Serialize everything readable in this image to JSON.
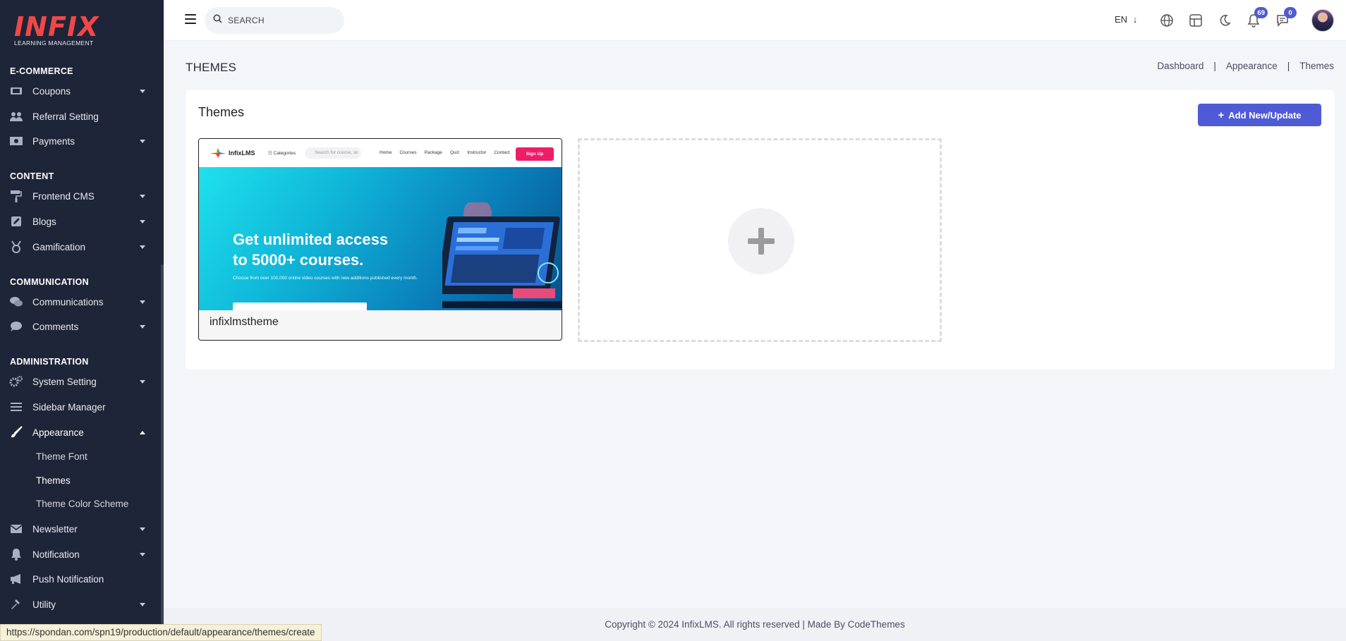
{
  "app": {
    "logo_word": "INFIX",
    "logo_tagline": "LEARNING MANAGEMENT"
  },
  "sidebar": {
    "sections": [
      {
        "label": "E-COMMERCE"
      },
      {
        "label": "CONTENT"
      },
      {
        "label": "COMMUNICATION"
      },
      {
        "label": "ADMINISTRATION"
      }
    ],
    "items": [
      {
        "label": "Coupons",
        "icon": "ticket-icon"
      },
      {
        "label": "Referral Setting",
        "icon": "users-icon"
      },
      {
        "label": "Payments",
        "icon": "money-icon"
      },
      {
        "label": "Frontend CMS",
        "icon": "paint-roller-icon"
      },
      {
        "label": "Blogs",
        "icon": "edit-icon"
      },
      {
        "label": "Gamification",
        "icon": "medal-icon"
      },
      {
        "label": "Communications",
        "icon": "chat-icon"
      },
      {
        "label": "Comments",
        "icon": "comment-icon"
      },
      {
        "label": "System Setting",
        "icon": "gears-icon"
      },
      {
        "label": "Sidebar Manager",
        "icon": "bars-icon"
      },
      {
        "label": "Appearance",
        "icon": "brush-icon"
      },
      {
        "label": "Newsletter",
        "icon": "envelope-icon"
      },
      {
        "label": "Notification",
        "icon": "bell-icon"
      },
      {
        "label": "Push Notification",
        "icon": "megaphone-icon"
      },
      {
        "label": "Utility",
        "icon": "hammer-icon"
      }
    ],
    "appearance_sub": [
      {
        "label": "Theme Font"
      },
      {
        "label": "Themes"
      },
      {
        "label": "Theme Color Scheme"
      }
    ]
  },
  "header": {
    "search_placeholder": "SEARCH",
    "language": "EN",
    "notifications_count": "69",
    "messages_count": "0"
  },
  "page": {
    "title": "THEMES",
    "breadcrumb": [
      "Dashboard",
      "Appearance",
      "Themes"
    ]
  },
  "card": {
    "title": "Themes",
    "add_button_label": "Add New/Update",
    "themes": [
      {
        "name": "infixlmstheme"
      }
    ]
  },
  "preview": {
    "brand": "InfixLMS",
    "categories": "Categories",
    "search": "Search for course, sk",
    "links": [
      "Home",
      "Courses",
      "Package",
      "Quiz",
      "Instructor",
      "Contact"
    ],
    "signup": "Sign Up",
    "hero_line1": "Get unlimited access",
    "hero_line2": "to 5000+ courses.",
    "hero_sub": "Choose from over 100,000 online video courses with new additions published every month."
  },
  "footer": {
    "copyright": "Copyright © 2024 InfixLMS. All rights reserved | Made By CodeThemes"
  },
  "status_bar": {
    "url": "https://spondan.com/spn19/production/default/appearance/themes/create"
  },
  "colors": {
    "sidebar_bg": "#1f2538",
    "accent": "#4f5bd5",
    "logo_red": "#f04848",
    "signup_pink": "#ee1d68"
  }
}
